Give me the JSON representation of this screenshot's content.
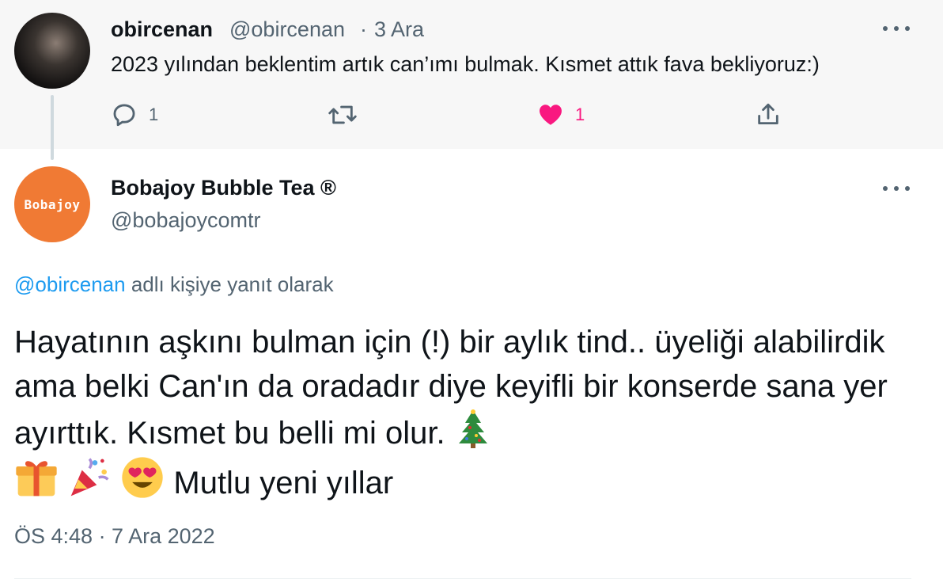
{
  "parent_tweet": {
    "display_name": "obircenan",
    "handle": "@obircenan",
    "separator": "·",
    "date": "3 Ara",
    "text": "2023 yılından beklentim artık can’ımı bulmak. Kısmet attık fava bekliyoruz:)",
    "actions": {
      "reply": {
        "icon": "reply-icon",
        "count": "1"
      },
      "retweet": {
        "icon": "retweet-icon",
        "count": ""
      },
      "like": {
        "icon": "heart-filled-icon",
        "count": "1",
        "color": "#f91880"
      },
      "share": {
        "icon": "share-icon"
      }
    }
  },
  "main_tweet": {
    "avatar_text": "Bobajoy",
    "avatar_color": "#f07a34",
    "display_name": "Bobajoy Bubble Tea ®",
    "handle": "@bobajoycomtr",
    "replying_mention": "@obircenan",
    "replying_suffix": "adlı kişiye yanıt olarak",
    "body_text": "Hayatının aşkını bulman için (!) bir aylık tind.. üyeliği alabilirdik ama belki Can'ın da oradadır diye keyifli bir konserde sana yer ayırttık. Kısmet bu belli mi olur.",
    "emojis": [
      "christmas-tree-icon",
      "gift-icon",
      "party-popper-icon",
      "heart-eyes-icon"
    ],
    "closing_text": "Mutlu yeni yıllar",
    "timestamp": "ÖS 4:48 · 7 Ara 2022"
  },
  "colors": {
    "link": "#1d9bf0",
    "secondary_text": "#536471",
    "parent_background": "#f7f7f7"
  }
}
